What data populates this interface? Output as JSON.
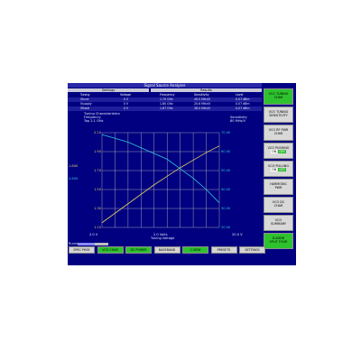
{
  "window": {
    "title": "Signal Source Analyzer"
  },
  "table": {
    "settings_header": "Settings",
    "results_header": "Results",
    "columns": [
      "Tuning",
      "Voltage",
      "Frequency",
      "Sensitivity",
      "Level"
    ],
    "rows": [
      {
        "tuning": "Vtune",
        "voltage": "0 V",
        "frequency": "1.70 GHz",
        "sensitivity": "49.0 MHz/V",
        "level": "0.07 dBm"
      },
      {
        "tuning": "Vsupply",
        "voltage": "0 V",
        "frequency": "1.80 GHz",
        "sensitivity": "20.6 MHz/V",
        "level": "0.07 dBm"
      },
      {
        "tuning": "Vfixed",
        "voltage": "0 V",
        "frequency": "1.87 GHz",
        "sensitivity": "38.0 MHz/V",
        "level": "0.07 dBm"
      }
    ]
  },
  "plot": {
    "title_lines": [
      "Tuning Characteristics",
      "Frequency",
      "Top 2.1 GHz"
    ],
    "right_caption_lines": [
      "Sensitivity",
      "80 MHz/V"
    ],
    "left_ticks": [
      "2.10",
      "1.90",
      "1.70",
      "1.50",
      "1.30",
      "1.10"
    ],
    "right_ticks": [
      "70.00",
      "60.00",
      "50.00",
      "40.00",
      "30.00",
      "20.00"
    ],
    "x_left": "2.0 V",
    "x_mid_top": "2.0 Volts",
    "x_mid_bottom": "Tuning Voltage",
    "x_right": "20.0 V",
    "marker_freq": "1.800",
    "marker_sens": "0.800",
    "colors": {
      "frequency": "#e6d060",
      "sensitivity": "#30c8d8",
      "grid": "#c8c8c8"
    }
  },
  "chart_data": {
    "type": "line",
    "x": [
      2,
      4,
      6,
      8,
      10,
      12,
      14,
      16,
      18,
      20
    ],
    "series": [
      {
        "values": [
          1.15,
          1.25,
          1.35,
          1.45,
          1.55,
          1.64,
          1.73,
          1.81,
          1.89,
          1.96
        ]
      },
      {
        "values": [
          69,
          67,
          65,
          62,
          59,
          56,
          51,
          46,
          40,
          33
        ]
      }
    ],
    "xlim": [
      2,
      20
    ],
    "ylim_left": [
      1.1,
      2.1
    ],
    "ylim_right": [
      20,
      70
    ],
    "grid": true
  },
  "status": {
    "label": "Running",
    "progress": 0.55
  },
  "softkeys": [
    {
      "lines": [
        "VCO TUNING",
        "CHAR"
      ],
      "active": true
    },
    {
      "lines": [
        "VCO TUNING",
        "SENSITIVITY"
      ],
      "active": false
    },
    {
      "lines": [
        "VCO RF PWR",
        "CHAR"
      ],
      "active": false
    },
    {
      "lines": [
        "VCO PUSHING"
      ],
      "onoff": true,
      "active": false
    },
    {
      "lines": [
        "VCO PULLING"
      ],
      "onoff": true,
      "active": false
    },
    {
      "lines": [
        "HARMONIC",
        "PWR"
      ],
      "active": false
    },
    {
      "lines": [
        "VCO DC",
        "CHAR"
      ],
      "active": false
    },
    {
      "lines": [
        "VCO",
        "SUMMARY"
      ],
      "active": false
    },
    {
      "lines": [
        "R-ADDR",
        "SPLIT FOUR"
      ],
      "active": true
    }
  ],
  "onoff_labels": {
    "on": "ON",
    "off": "OFF"
  },
  "bottom_keys": [
    {
      "label": "SPEC PHSE",
      "active": false
    },
    {
      "label": "VCO CHAR",
      "active": true
    },
    {
      "label": "DC POWER",
      "active": true
    },
    {
      "label": "BASEBAND",
      "active": false
    },
    {
      "label": "C-VIEW",
      "active": true
    },
    {
      "label": "PRESETS",
      "active": false
    },
    {
      "label": "SETTINGS",
      "active": false
    }
  ]
}
